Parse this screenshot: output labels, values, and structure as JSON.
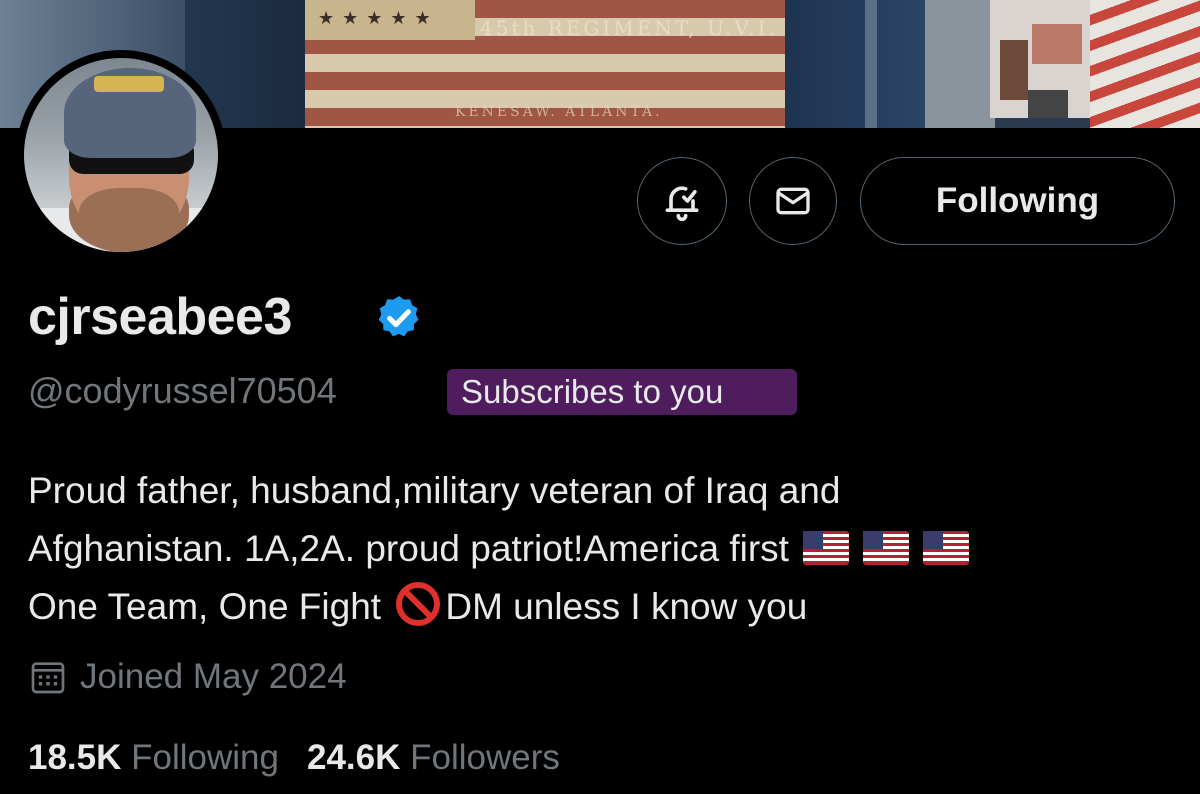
{
  "banner": {
    "flag_text": "45th REGIMENT, U.V.I.",
    "flag_text_lower": "KENESAW. ATLANTA."
  },
  "profile": {
    "display_name": "cjrseabee3",
    "verified": true,
    "handle": "@codyrussel70504",
    "subscribes_badge": "Subscribes to you",
    "bio_lines": [
      "Proud father, husband,military veteran of Iraq and",
      "Afghanistan. 1A,2A. proud patriot!America first",
      "One Team, One Fight",
      "DM unless I know you"
    ],
    "joined": "Joined May 2024",
    "following_count": "18.5K",
    "following_label": "Following",
    "followers_count": "24.6K",
    "followers_label": "Followers"
  },
  "actions": {
    "follow_button_label": "Following",
    "notification_icon": "bell-check-icon",
    "message_icon": "envelope-icon"
  },
  "colors": {
    "background": "#000000",
    "text_primary": "#e7e9ea",
    "text_secondary": "#71767b",
    "border": "#536471",
    "verified": "#1d9bf0",
    "subscribe_badge_bg": "#4f1c5e"
  }
}
